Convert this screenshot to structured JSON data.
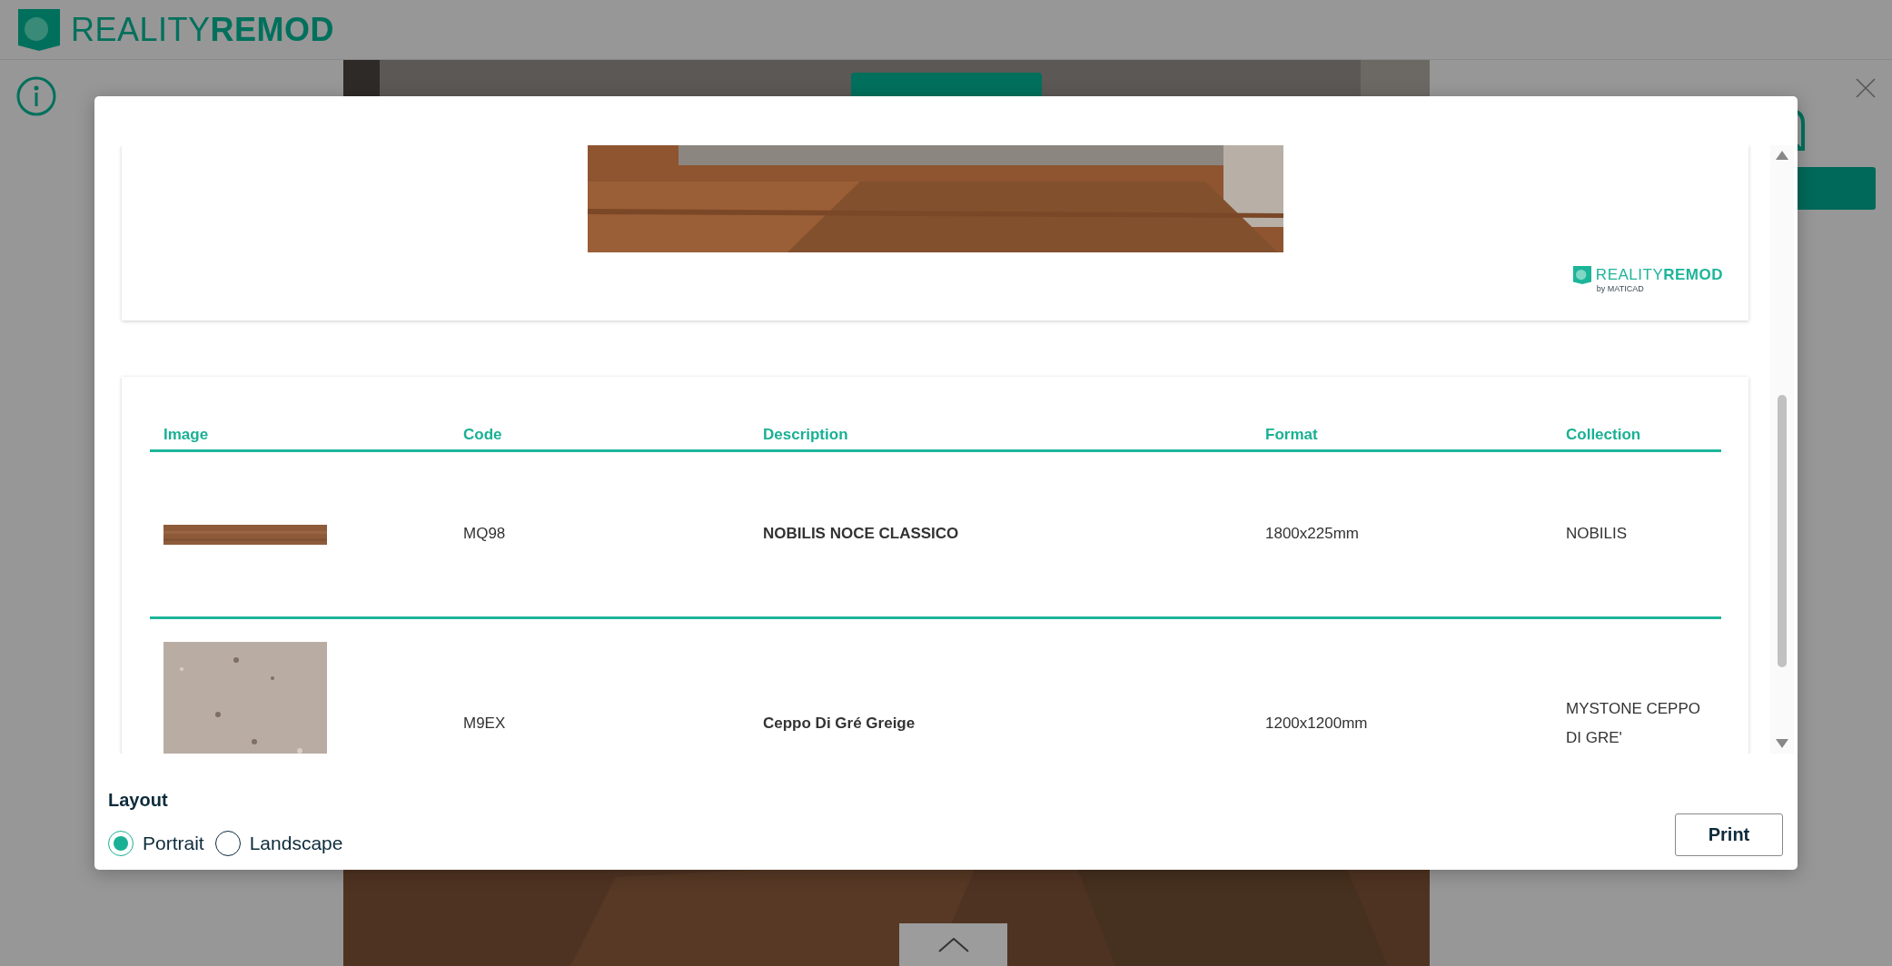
{
  "header": {
    "logo": "REALITY**REMOD**"
  },
  "modal": {
    "preview": {
      "logo": "REALITY**REMOD**",
      "logo_byline": "by MATICAD"
    },
    "table": {
      "columns": [
        "Image",
        "Code",
        "Description",
        "Format",
        "Collection"
      ],
      "rows": [
        {
          "kind": "wood",
          "code": "MQ98",
          "description": "NOBILIS NOCE CLASSICO",
          "format": "1800x225mm",
          "collection": "NOBILIS"
        },
        {
          "kind": "stone",
          "code": "M9EX",
          "description": "Ceppo Di Gré Greige",
          "format": "1200x1200mm",
          "collection": "MYSTONE CEPPO DI GRE'"
        }
      ]
    },
    "layout": {
      "title": "Layout",
      "options": [
        {
          "label": "Portrait",
          "selected": true
        },
        {
          "label": "Landscape",
          "selected": false
        }
      ]
    },
    "print_button": "Print"
  }
}
